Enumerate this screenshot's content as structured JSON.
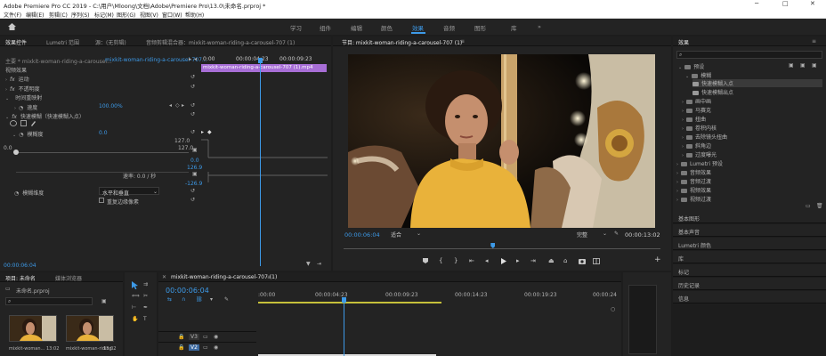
{
  "app": {
    "title": "Adobe Premiere Pro CC 2019 - C:\\用户\\Mloong\\文档\\Adobe\\Premiere Pro\\13.0\\未命名.prproj *",
    "window_controls": [
      "─",
      "□",
      "✕"
    ]
  },
  "menu": [
    "文件(F)",
    "编辑(E)",
    "剪辑(C)",
    "序列(S)",
    "标记(M)",
    "图形(G)",
    "视图(V)",
    "窗口(W)",
    "帮助(H)"
  ],
  "workspaces": {
    "items": [
      "学习",
      "组件",
      "编辑",
      "颜色",
      "效果",
      "音频",
      "图形",
      "库"
    ],
    "active": "效果",
    "overflow": "»"
  },
  "effect_controls": {
    "tabs": [
      "效果控件",
      "Lumetri 范围",
      "源：(无剪辑)",
      "音频剪辑混合器：mixkit-woman-riding-a-carousel-707 (1)"
    ],
    "source_row": {
      "master": "主要 * mixkit-woman-riding-a-carousel...",
      "clip": "mixkit-woman-riding-a-carousel-707..."
    },
    "mini_ruler": [
      "0:00",
      "00:00:04:23",
      "00:00:09:23"
    ],
    "clip_label": "mixkit-woman-riding-a-carousel-707 (1).mp4",
    "section": "视频效果",
    "rows": [
      {
        "label": "运动",
        "fx": "fx"
      },
      {
        "label": "不透明度",
        "fx": "fx"
      },
      {
        "label": "时间重映射",
        "fx": ""
      },
      {
        "label": "速度",
        "value": "100.00%"
      },
      {
        "label": "快速模糊（快速模糊入点）",
        "fx": "fx"
      },
      {
        "label": "模糊度",
        "value": "0.0"
      }
    ],
    "graph": {
      "top": "127.0",
      "second": "127.0",
      "zero_a": "0.0",
      "zero_b": "0.0",
      "v_top": "126.9",
      "v_bottom": "-126.9",
      "velocity": "速率: 0.0 / 秒"
    },
    "dimension_label": "模糊维度",
    "dimension_value": "水平和垂直",
    "repeat_label": "重复边缘像素",
    "timecode": "00:00:06:04"
  },
  "program_monitor": {
    "tab": "节目: mixkit-woman-riding-a-carousel-707 (1)",
    "menu_icon": "≡",
    "timecode": "00:00:06:04",
    "fit": "适合",
    "quality": "完整",
    "duration": "00:00:13:02",
    "playhead_fraction": 0.47,
    "transport": [
      "marker-icon",
      "in-point-icon",
      "out-point-icon",
      "go-to-in-icon",
      "step-back-icon",
      "play-icon",
      "step-forward-icon",
      "go-to-out-icon",
      "lift-icon",
      "extract-icon",
      "export-frame-icon",
      "comparison-icon"
    ],
    "plus": "+"
  },
  "effects_panel": {
    "title": "效果",
    "search_placeholder": "",
    "tree": [
      {
        "label": "预设",
        "level": 0,
        "open": true
      },
      {
        "label": "模糊",
        "level": 1,
        "open": true
      },
      {
        "label": "快速模糊入点",
        "level": 2,
        "highlight": true
      },
      {
        "label": "快速模糊出点",
        "level": 2
      },
      {
        "label": "画中画",
        "level": 1
      },
      {
        "label": "马赛克",
        "level": 1
      },
      {
        "label": "扭曲",
        "level": 1
      },
      {
        "label": "卷积内核",
        "level": 1
      },
      {
        "label": "去除镜头扭曲",
        "level": 1
      },
      {
        "label": "斜角边",
        "level": 1
      },
      {
        "label": "过度曝光",
        "level": 1
      },
      {
        "label": "Lumetri 预设",
        "level": 0
      },
      {
        "label": "音频效果",
        "level": 0
      },
      {
        "label": "音频过渡",
        "level": 0
      },
      {
        "label": "视频效果",
        "level": 0
      },
      {
        "label": "视频过渡",
        "level": 0
      }
    ],
    "stacked": [
      "基本图形",
      "基本声音",
      "Lumetri 颜色",
      "库",
      "标记",
      "历史记录",
      "信息"
    ]
  },
  "project_panel": {
    "tabs": [
      "项目: 未命名",
      "媒体浏览器"
    ],
    "project_file": "未命名.prproj",
    "items": [
      {
        "name": "mixkit-woman...",
        "duration": "13:02"
      },
      {
        "name": "mixkit-woman-riding...",
        "duration": "13:02"
      }
    ]
  },
  "timeline": {
    "tab": "mixkit-woman-riding-a-carousel-707 (1)",
    "timecode": "00:00:06:04",
    "ruler": [
      ":00:00",
      "00:00:04:23",
      "00:00:09:23",
      "00:00:14:23",
      "00:00:19:23",
      "00:00:24"
    ],
    "tracks": [
      "V3",
      "V2"
    ]
  },
  "colors": {
    "accent": "#3d9ae8",
    "clip": "#a76ed6",
    "panel": "#232323",
    "background": "#1d1d1d"
  }
}
